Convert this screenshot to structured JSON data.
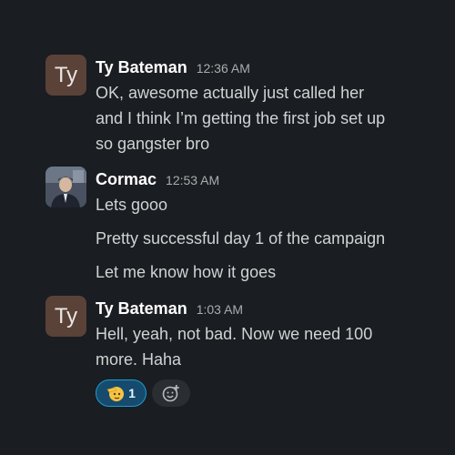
{
  "messages": [
    {
      "sender": "Ty Bateman",
      "time": "12:36 AM",
      "avatar_initials": "Ty",
      "lines": [
        "OK, awesome actually just called her",
        "and I think I’m getting the first job set up",
        "so gangster bro"
      ]
    },
    {
      "sender": "Cormac",
      "time": "12:53 AM",
      "lines": [
        "Lets gooo",
        "Pretty successful day 1 of the campaign",
        "Let me know how it goes"
      ]
    },
    {
      "sender": "Ty Bateman",
      "time": "1:03 AM",
      "avatar_initials": "Ty",
      "lines": [
        "Hell, yeah, not bad. Now we need 100",
        "more. Haha"
      ],
      "reactions": [
        {
          "icon": "saluting-face-icon",
          "count": "1"
        }
      ],
      "add_reaction_icon": "add-reaction-icon"
    }
  ],
  "colors": {
    "background": "#1a1d21",
    "avatar_ty": "#5a4238",
    "reaction_bg": "#164b6e",
    "reaction_border": "#1d9bd1"
  }
}
